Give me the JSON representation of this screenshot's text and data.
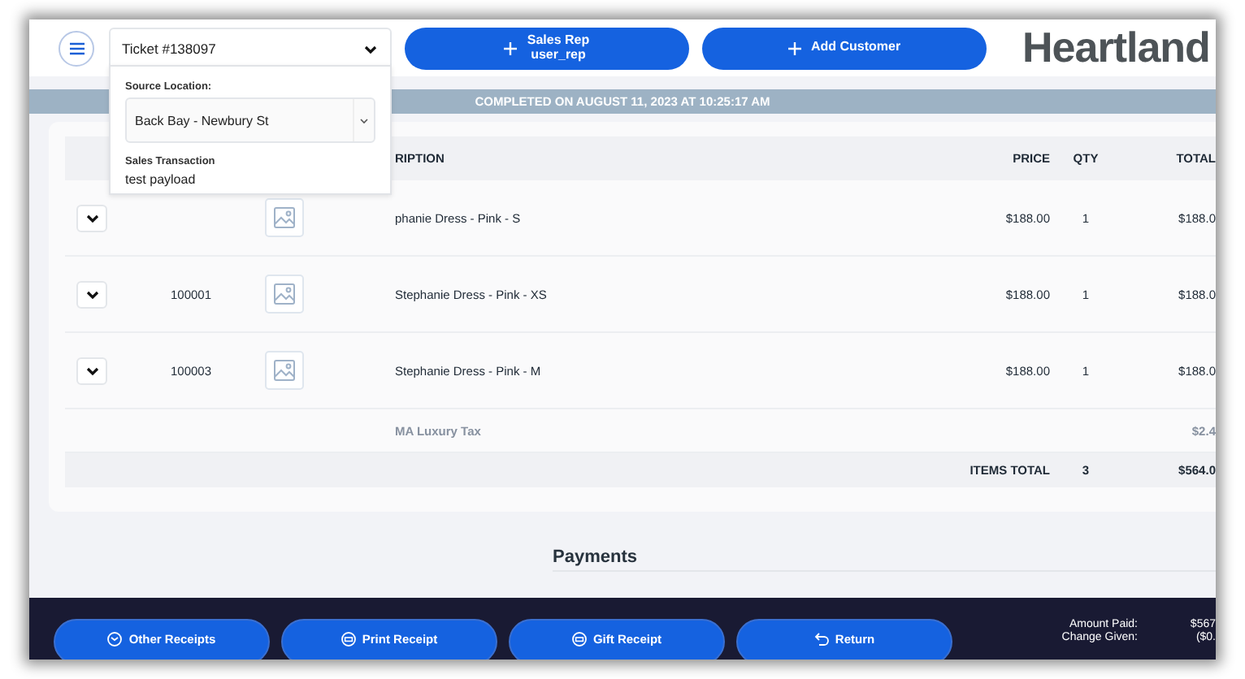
{
  "header": {
    "ticket_select": {
      "value": "Ticket #138097",
      "expanded": true
    },
    "buttons": [
      {
        "label": "Sales Rep",
        "sublabel": "user_rep"
      },
      {
        "label": "Add Customer"
      }
    ],
    "logo": "Heartland"
  },
  "ticket_details": {
    "source_location_label": "Source Location:",
    "source_location": "Back Bay - Newbury St",
    "transaction_label": "Sales Transaction",
    "transaction_value": "test payload"
  },
  "banner": "COMPLETED ON AUGUST 11, 2023 AT 10:25:17 AM",
  "table": {
    "columns": [
      "RIPTION",
      "PRICE",
      "QTY",
      "TOTAL"
    ],
    "rows": [
      {
        "kind": "item",
        "description": "phanie Dress - Pink - S",
        "price": "$188.00",
        "qty": "1",
        "total": "$188.0"
      },
      {
        "kind": "item",
        "sku": "100001",
        "description": "Stephanie Dress - Pink - XS",
        "price": "$188.00",
        "qty": "1",
        "total": "$188.0"
      },
      {
        "kind": "item",
        "sku": "100003",
        "description": "Stephanie Dress - Pink - M",
        "price": "$188.00",
        "qty": "1",
        "total": "$188.0"
      },
      {
        "kind": "tax",
        "description": "MA Luxury Tax",
        "total": "$2.4"
      },
      {
        "kind": "total",
        "label": "ITEMS TOTAL",
        "qty": "3",
        "total": "$564.0"
      }
    ]
  },
  "payments_title": "Payments",
  "footer": {
    "buttons": [
      {
        "kind": "receipt",
        "label": "Other Receipts"
      },
      {
        "kind": "print",
        "label": "Print Receipt"
      },
      {
        "kind": "print",
        "label": "Gift Receipt"
      },
      {
        "kind": "return",
        "label": "Return"
      }
    ],
    "summary": [
      {
        "label": "Amount Paid:",
        "value": "$567"
      },
      {
        "label": "Change Given:",
        "value": "($0."
      }
    ]
  }
}
